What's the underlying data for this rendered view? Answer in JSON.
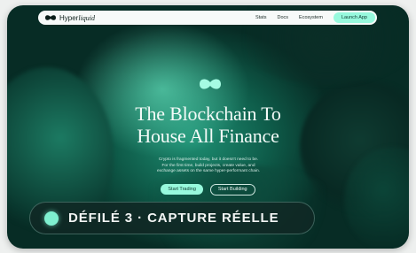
{
  "nav": {
    "brand": "Hyperliquid",
    "brand_plain": "Hyper",
    "brand_italic": "liquid",
    "links": [
      "Stats",
      "Docs",
      "Ecosystem"
    ],
    "launch_label": "Launch App"
  },
  "hero": {
    "title_line1": "The Blockchain To",
    "title_line2": "House All Finance",
    "subtitle_line1": "Crypto is fragmented today, but it doesn't need to be.",
    "subtitle_line2": "For the first time, build projects, create value, and",
    "subtitle_line3": "exchange assets on the same hyper-performant chain.",
    "primary_button": "Start Trading",
    "secondary_button": "Start Building"
  },
  "badge": {
    "label": "DÉFILÉ 3 · CAPTURE RÉELLE"
  },
  "colors": {
    "accent": "#97f9dd",
    "background": "#072c25",
    "nav_bg": "#f7faf9"
  }
}
